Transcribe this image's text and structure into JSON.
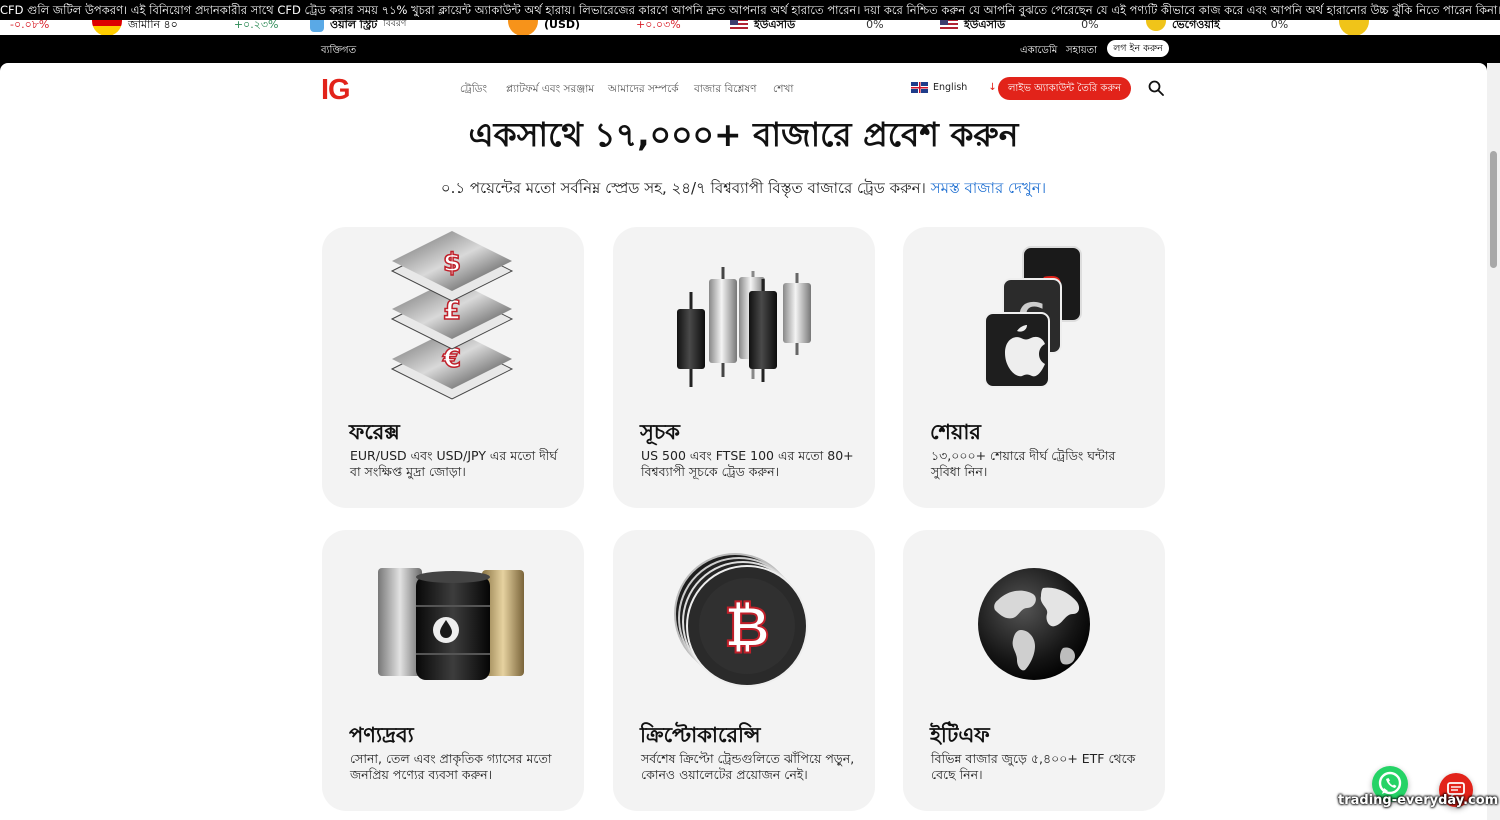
{
  "risk_warning": "CFD গুলি জটিল উপকরণ। এই বিনিয়োগ প্রদানকারীর সাথে CFD ট্রেড করার সময় ৭১% খুচরা ক্লায়েন্ট অ্যাকাউন্ট অর্থ হারায়। লিভারেজের কারণে আপনি দ্রুত আপনার অর্থ হারাতে পারেন। দয়া করে নিশ্চিত করুন যে আপনি বুঝতে পেরেছেন যে এই পণ্যটি কীভাবে কাজ করে এবং আপনি অর্থ হারানোর উচ্চ ঝুঁকি নিতে পারেন কিনা।",
  "ticker": [
    {
      "name": "",
      "change": "-০.০৮%",
      "tone": "neg"
    },
    {
      "name": "জার্মানি ৪০",
      "change": "+০.২৩%",
      "tone": "pos"
    },
    {
      "name": "ওয়াল স্ট্রিট",
      "change": "বিবরণ",
      "tone": "muted"
    },
    {
      "name": "(USD)",
      "change": "+০.০৩%",
      "tone": "neg"
    },
    {
      "name": "ইউএসডি",
      "change": "0%",
      "tone": "muted"
    },
    {
      "name": "ইউএসডি",
      "change": "0%",
      "tone": "muted"
    },
    {
      "name": "ভেগেওয়াই",
      "change": "0%",
      "tone": "muted"
    }
  ],
  "util": {
    "personal": "ব্যক্তিগত",
    "academy": "একাডেমি",
    "help": "সহায়তা",
    "login": "লগ ইন করুন"
  },
  "header": {
    "logo": "IG",
    "nav": [
      "ট্রেডিং",
      "প্ল্যাটফর্ম এবং সরঞ্জাম",
      "আমাদের সম্পর্কে",
      "বাজার বিশ্লেষণ",
      "শেখা"
    ],
    "language": "English",
    "cta": "লাইভ অ্যাকাউন্ট তৈরি করুন"
  },
  "hero": {
    "title": "একসাথে ১৭,০০০+ বাজারে প্রবেশ করুন",
    "subtitle": "০.১ পয়েন্টের মতো সর্বনিম্ন স্প্রেড সহ, ২৪/৭ বিশ্বব্যাপী বিস্তৃত বাজারে ট্রেড করুন।",
    "link": "সমস্ত বাজার দেখুন।"
  },
  "cards": [
    {
      "title": "ফরেক্স",
      "desc": "EUR/USD এবং USD/JPY এর মতো দীর্ঘ বা সংক্ষিপ্ত মুদ্রা জোড়া।",
      "icon": "forex-icon"
    },
    {
      "title": "সূচক",
      "desc": "US 500 এবং FTSE 100 এর মতো 80+ বিশ্বব্যাপী সূচকে ট্রেড করুন।",
      "icon": "candlestick-icon"
    },
    {
      "title": "শেয়ার",
      "desc": "১৩,০০০+ শেয়ারে দীর্ঘ ট্রেডিং ঘন্টার সুবিধা নিন।",
      "icon": "shares-icon"
    },
    {
      "title": "পণ্যদ্রব্য",
      "desc": "সোনা, তেল এবং প্রাকৃতিক গ্যাসের মতো জনপ্রিয় পণ্যের ব্যবসা করুন।",
      "icon": "commodities-icon"
    },
    {
      "title": "ক্রিপ্টোকারেন্সি",
      "desc": "সর্বশেষ ক্রিপ্টো ট্রেন্ডগুলিতে ঝাঁপিয়ে পড়ুন, কোনও ওয়ালেটের প্রয়োজন নেই।",
      "icon": "bitcoin-icon"
    },
    {
      "title": "ইটিএফ",
      "desc": "বিভিন্ন বাজার জুড়ে ৫,৪০০+ ETF থেকে বেছে নিন।",
      "icon": "globe-icon"
    }
  ],
  "watermark": "trading-everyday.com",
  "colors": {
    "brand": "#e2231a",
    "link": "#1f6fd1",
    "card": "#f3f3f3"
  }
}
